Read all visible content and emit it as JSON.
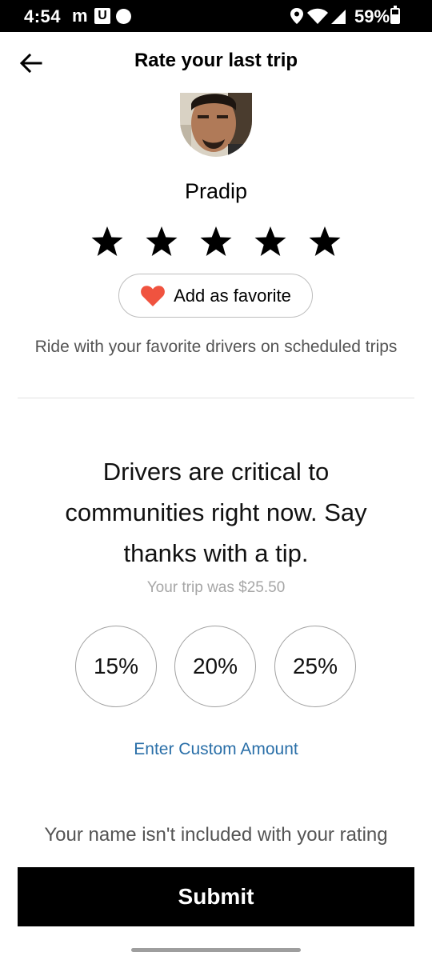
{
  "status_bar": {
    "time": "4:54",
    "app_icon_mc": "m",
    "app_icon_u": "U",
    "battery": "59%",
    "icons": [
      "mcdonalds-icon",
      "u-app-icon",
      "circle-notification-icon",
      "location-icon",
      "wifi-icon",
      "cell-signal-icon",
      "battery-icon"
    ]
  },
  "header": {
    "title": "Rate your last trip",
    "back_icon": "back-arrow-icon"
  },
  "driver": {
    "name": "Pradip",
    "rating_stars": 5,
    "rating_max": 5
  },
  "favorite": {
    "button_label": "Add as favorite",
    "icon": "heart-icon",
    "heart_color": "#f0533f",
    "caption": "Ride with your favorite drivers on scheduled trips"
  },
  "tip": {
    "headline": "Drivers are critical to communities right now. Say thanks with a tip.",
    "trip_cost": "Your trip was $25.50",
    "options": [
      "15%",
      "20%",
      "25%"
    ],
    "custom_label": "Enter Custom Amount",
    "link_color": "#2a6fa8"
  },
  "footer": {
    "privacy_note": "Your name isn't included with your rating",
    "submit_label": "Submit"
  }
}
